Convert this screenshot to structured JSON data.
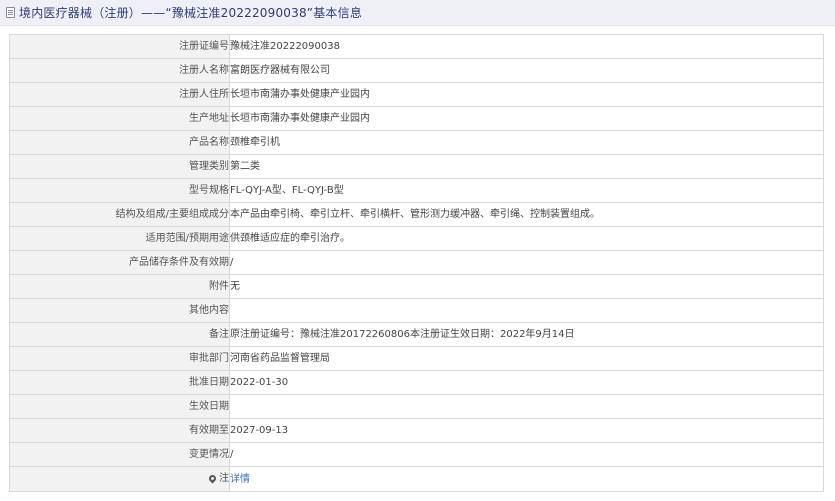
{
  "header": {
    "title": "境内医疗器械（注册）——“豫械注准20222090038”基本信息"
  },
  "rows": [
    {
      "label": "注册证编号",
      "value": "豫械注准20222090038"
    },
    {
      "label": "注册人名称",
      "value": "富朗医疗器械有限公司"
    },
    {
      "label": "注册人住所",
      "value": "长垣市南蒲办事处健康产业园内"
    },
    {
      "label": "生产地址",
      "value": "长垣市南蒲办事处健康产业园内"
    },
    {
      "label": "产品名称",
      "value": "颈椎牵引机"
    },
    {
      "label": "管理类别",
      "value": "第二类"
    },
    {
      "label": "型号规格",
      "value": "FL-QYJ-A型、FL-QYJ-B型"
    },
    {
      "label": "结构及组成/主要组成成分",
      "value": "本产品由牵引椅、牵引立杆、牵引横杆、管形测力缓冲器、牵引绳、控制装置组成。"
    },
    {
      "label": "适用范围/预期用途",
      "value": "供颈椎适应症的牵引治疗。"
    },
    {
      "label": "产品储存条件及有效期",
      "value": "/"
    },
    {
      "label": "附件",
      "value": "无"
    },
    {
      "label": "其他内容",
      "value": ""
    },
    {
      "label": "备注",
      "value": "原注册证编号：豫械注准20172260806本注册证生效日期：2022年9月14日"
    },
    {
      "label": "审批部门",
      "value": "河南省药品监督管理局"
    },
    {
      "label": "批准日期",
      "value": "2022-01-30"
    },
    {
      "label": "生效日期",
      "value": ""
    },
    {
      "label": "有效期至",
      "value": "2027-09-13"
    },
    {
      "label": "变更情况",
      "value": "/"
    }
  ],
  "note_row": {
    "icon": "pin-icon",
    "label": "注",
    "link_text": "详情"
  }
}
